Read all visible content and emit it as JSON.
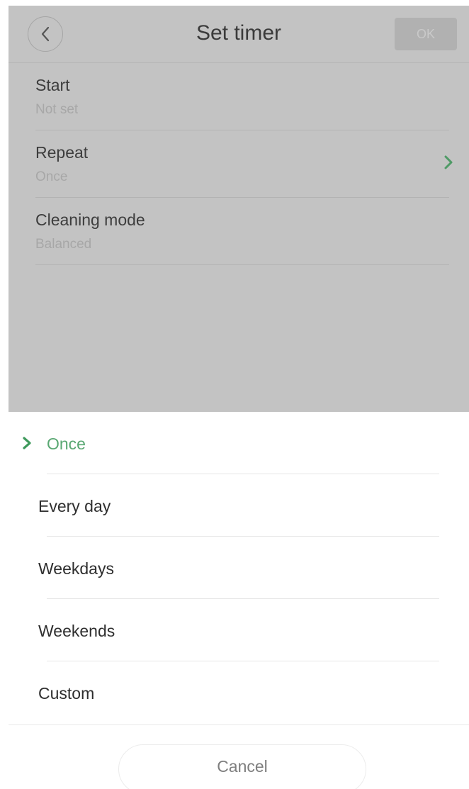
{
  "header": {
    "title": "Set timer",
    "ok_label": "OK",
    "back_icon": "chevron-left-icon"
  },
  "settings": [
    {
      "label": "Start",
      "value": "Not set",
      "has_chevron": false
    },
    {
      "label": "Repeat",
      "value": "Once",
      "has_chevron": true
    },
    {
      "label": "Cleaning mode",
      "value": "Balanced",
      "has_chevron": false
    }
  ],
  "repeat_sheet": {
    "options": [
      {
        "label": "Once",
        "selected": true
      },
      {
        "label": "Every day",
        "selected": false
      },
      {
        "label": "Weekdays",
        "selected": false
      },
      {
        "label": "Weekends",
        "selected": false
      },
      {
        "label": "Custom",
        "selected": false
      }
    ],
    "cancel_label": "Cancel"
  },
  "colors": {
    "accent": "#5aa873",
    "overlay": "#c3c3c3",
    "text_primary": "#2e2e2e",
    "text_muted": "#a7a7a7"
  }
}
